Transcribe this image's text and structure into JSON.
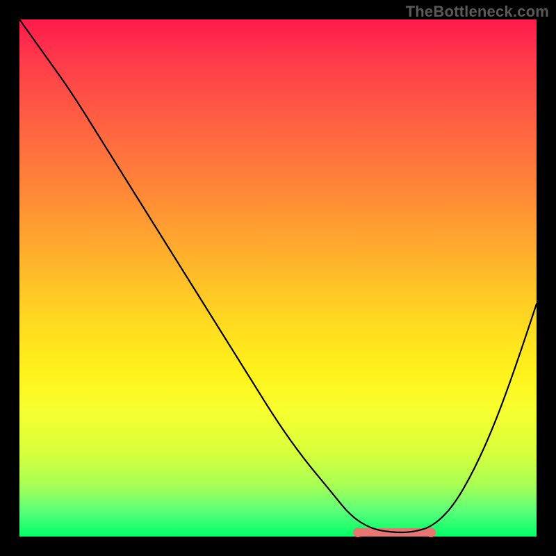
{
  "watermark": "TheBottleneck.com",
  "colors": {
    "frame": "#000000",
    "curve": "#000000",
    "highlight": "#e6766f",
    "watermark": "#5a5a5a",
    "gradient_top": "#ff1a4d",
    "gradient_bottom": "#00ff66"
  },
  "chart_data": {
    "type": "line",
    "title": "",
    "xlabel": "",
    "ylabel": "",
    "xlim": [
      0,
      100
    ],
    "ylim": [
      0,
      100
    ],
    "x": [
      0,
      5,
      10,
      15,
      20,
      25,
      30,
      35,
      40,
      45,
      50,
      55,
      60,
      64,
      68,
      72,
      76,
      80,
      84,
      88,
      92,
      96,
      100
    ],
    "values": [
      100,
      93,
      86,
      78,
      70,
      62,
      54,
      46,
      38,
      30,
      22,
      15,
      9,
      4,
      1.5,
      0.8,
      0.8,
      2,
      6,
      13,
      22,
      33,
      45
    ],
    "highlight_range_x": [
      65,
      80
    ],
    "description": "Single continuous curve over a vertical rainbow gradient; curve starts at top-left, slopes steeply down to a flat valley near x≈70, then rises again toward the right. Salmon-colored segment marks the flat valley region. Background gradient goes red (top, high values) to green (bottom, low values). No axis ticks, labels, grid, or legend are shown."
  }
}
